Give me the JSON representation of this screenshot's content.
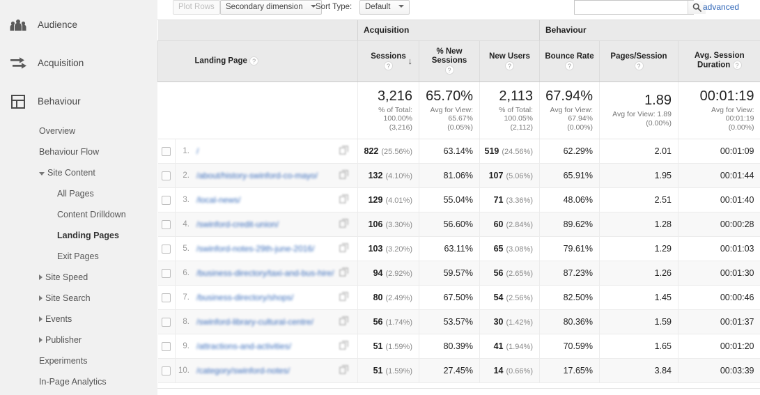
{
  "colors": {
    "link": "#2a62b6",
    "sidebar_bg": "#f1f1f1",
    "header_bg": "#eaeaea",
    "text": "#222222",
    "muted": "#888888"
  },
  "sidebar": {
    "top_items": [
      {
        "label": "Audience",
        "icon": "audience-people-icon"
      },
      {
        "label": "Acquisition",
        "icon": "acquisition-arrows-icon"
      },
      {
        "label": "Behaviour",
        "icon": "behaviour-layout-icon"
      }
    ],
    "behaviour_children": [
      {
        "label": "Overview",
        "level": 1,
        "caret": "none",
        "active": false
      },
      {
        "label": "Behaviour Flow",
        "level": 1,
        "caret": "none",
        "active": false
      },
      {
        "label": "Site Content",
        "level": 1,
        "caret": "open",
        "active": false
      },
      {
        "label": "All Pages",
        "level": 2,
        "caret": "none",
        "active": false
      },
      {
        "label": "Content Drilldown",
        "level": 2,
        "caret": "none",
        "active": false
      },
      {
        "label": "Landing Pages",
        "level": 2,
        "caret": "none",
        "active": true
      },
      {
        "label": "Exit Pages",
        "level": 2,
        "caret": "none",
        "active": false
      },
      {
        "label": "Site Speed",
        "level": 1,
        "caret": "closed",
        "active": false
      },
      {
        "label": "Site Search",
        "level": 1,
        "caret": "closed",
        "active": false
      },
      {
        "label": "Events",
        "level": 1,
        "caret": "closed",
        "active": false
      },
      {
        "label": "Publisher",
        "level": 1,
        "caret": "closed",
        "active": false
      },
      {
        "label": "Experiments",
        "level": 1,
        "caret": "none",
        "active": false
      },
      {
        "label": "In-Page Analytics",
        "level": 1,
        "caret": "none",
        "active": false
      }
    ]
  },
  "toolbar": {
    "plot_rows_label": "Plot Rows",
    "secondary_dimension_label": "Secondary dimension",
    "sort_type_label": "Sort Type:",
    "sort_type_value": "Default",
    "search_value": "",
    "search_placeholder": "",
    "search_icon": "search-magnifier-icon",
    "advanced_label": "advanced"
  },
  "table": {
    "dimension_header": "Landing Page",
    "help_glyph": "?",
    "sort_glyph": "↓",
    "groups": [
      {
        "label": "Acquisition",
        "span": 3
      },
      {
        "label": "Behaviour",
        "span": 3
      }
    ],
    "metrics": [
      {
        "label_line1": "Sessions",
        "label_line2": "",
        "sorted": true
      },
      {
        "label_line1": "% New",
        "label_line2": "Sessions",
        "sorted": false
      },
      {
        "label_line1": "New Users",
        "label_line2": "",
        "sorted": false
      },
      {
        "label_line1": "Bounce Rate",
        "label_line2": "",
        "sorted": false
      },
      {
        "label_line1": "Pages/Session",
        "label_line2": "",
        "sorted": false
      },
      {
        "label_line1": "Avg. Session",
        "label_line2": "Duration",
        "sorted": false
      }
    ],
    "summary": [
      {
        "value": "3,216",
        "l1": "% of Total:",
        "l2": "100.00%",
        "l3": "(3,216)"
      },
      {
        "value": "65.70%",
        "l1": "Avg for View:",
        "l2": "65.67%",
        "l3": "(0.05%)"
      },
      {
        "value": "2,113",
        "l1": "% of Total:",
        "l2": "100.05%",
        "l3": "(2,112)"
      },
      {
        "value": "67.94%",
        "l1": "Avg for View:",
        "l2": "67.94%",
        "l3": "(0.00%)"
      },
      {
        "value": "1.89",
        "l1": "Avg for View: 1.89",
        "l2": "(0.00%)",
        "l3": ""
      },
      {
        "value": "00:01:19",
        "l1": "Avg for View:",
        "l2": "00:01:19",
        "l3": "(0.00%)"
      }
    ],
    "rows": [
      {
        "index": "1.",
        "page": "/",
        "sessions": "822",
        "sessions_pct": "(25.56%)",
        "new_sessions_pct": "63.14%",
        "new_users": "519",
        "new_users_pct": "(24.56%)",
        "bounce_rate": "62.29%",
        "pages_session": "2.01",
        "avg_duration": "00:01:09"
      },
      {
        "index": "2.",
        "page": "/about/history-swinford-co-mayo/",
        "sessions": "132",
        "sessions_pct": "(4.10%)",
        "new_sessions_pct": "81.06%",
        "new_users": "107",
        "new_users_pct": "(5.06%)",
        "bounce_rate": "65.91%",
        "pages_session": "1.95",
        "avg_duration": "00:01:44"
      },
      {
        "index": "3.",
        "page": "/local-news/",
        "sessions": "129",
        "sessions_pct": "(4.01%)",
        "new_sessions_pct": "55.04%",
        "new_users": "71",
        "new_users_pct": "(3.36%)",
        "bounce_rate": "48.06%",
        "pages_session": "2.51",
        "avg_duration": "00:01:40"
      },
      {
        "index": "4.",
        "page": "/swinford-credit-union/",
        "sessions": "106",
        "sessions_pct": "(3.30%)",
        "new_sessions_pct": "56.60%",
        "new_users": "60",
        "new_users_pct": "(2.84%)",
        "bounce_rate": "89.62%",
        "pages_session": "1.28",
        "avg_duration": "00:00:28"
      },
      {
        "index": "5.",
        "page": "/swinford-notes-29th-june-2016/",
        "sessions": "103",
        "sessions_pct": "(3.20%)",
        "new_sessions_pct": "63.11%",
        "new_users": "65",
        "new_users_pct": "(3.08%)",
        "bounce_rate": "79.61%",
        "pages_session": "1.29",
        "avg_duration": "00:01:03"
      },
      {
        "index": "6.",
        "page": "/business-directory/taxi-and-bus-hire/",
        "sessions": "94",
        "sessions_pct": "(2.92%)",
        "new_sessions_pct": "59.57%",
        "new_users": "56",
        "new_users_pct": "(2.65%)",
        "bounce_rate": "87.23%",
        "pages_session": "1.26",
        "avg_duration": "00:01:30"
      },
      {
        "index": "7.",
        "page": "/business-directory/shops/",
        "sessions": "80",
        "sessions_pct": "(2.49%)",
        "new_sessions_pct": "67.50%",
        "new_users": "54",
        "new_users_pct": "(2.56%)",
        "bounce_rate": "82.50%",
        "pages_session": "1.45",
        "avg_duration": "00:00:46"
      },
      {
        "index": "8.",
        "page": "/swinford-library-cultural-centre/",
        "sessions": "56",
        "sessions_pct": "(1.74%)",
        "new_sessions_pct": "53.57%",
        "new_users": "30",
        "new_users_pct": "(1.42%)",
        "bounce_rate": "80.36%",
        "pages_session": "1.59",
        "avg_duration": "00:01:37"
      },
      {
        "index": "9.",
        "page": "/attractions-and-activities/",
        "sessions": "51",
        "sessions_pct": "(1.59%)",
        "new_sessions_pct": "80.39%",
        "new_users": "41",
        "new_users_pct": "(1.94%)",
        "bounce_rate": "70.59%",
        "pages_session": "1.65",
        "avg_duration": "00:01:20"
      },
      {
        "index": "10.",
        "page": "/category/swinford-notes/",
        "sessions": "51",
        "sessions_pct": "(1.59%)",
        "new_sessions_pct": "27.45%",
        "new_users": "14",
        "new_users_pct": "(0.66%)",
        "bounce_rate": "17.65%",
        "pages_session": "3.84",
        "avg_duration": "00:03:39"
      }
    ]
  }
}
